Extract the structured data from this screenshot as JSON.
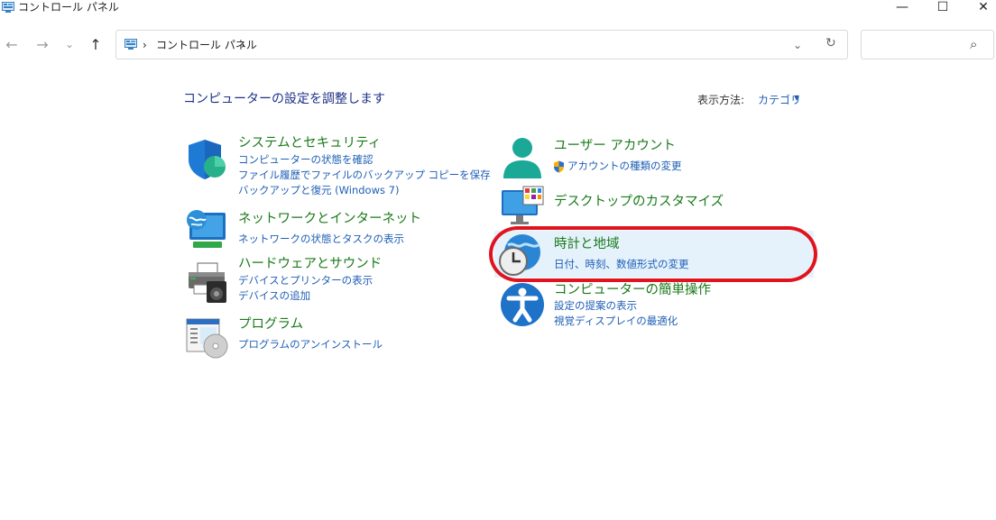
{
  "window": {
    "title": "コントロール パネル",
    "minimize_glyph": "—",
    "maximize_glyph": "☐",
    "close_glyph": "✕"
  },
  "nav": {
    "back_glyph": "←",
    "forward_glyph": "→",
    "recent_glyph": "⌄",
    "up_glyph": "↑"
  },
  "address": {
    "sep_glyph": "›",
    "crumb": "コントロール パネル",
    "dropdown_glyph": "⌄",
    "refresh_glyph": "↻"
  },
  "search": {
    "placeholder": "",
    "icon_glyph": "⌕"
  },
  "main": {
    "heading": "コンピューターの設定を調整します",
    "view_by_label": "表示方法:",
    "view_by_value": "カテゴリ",
    "view_by_arrow": "▾"
  },
  "categories": [
    {
      "title": "システムとセキュリティ",
      "links": [
        "コンピューターの状態を確認",
        "ファイル履歴でファイルのバックアップ コピーを保存",
        "バックアップと復元 (Windows 7)"
      ]
    },
    {
      "title": "ネットワークとインターネット",
      "links": [
        "ネットワークの状態とタスクの表示"
      ]
    },
    {
      "title": "ハードウェアとサウンド",
      "links": [
        "デバイスとプリンターの表示",
        "デバイスの追加"
      ]
    },
    {
      "title": "プログラム",
      "links": [
        "プログラムのアンインストール"
      ]
    },
    {
      "title": "ユーザー アカウント",
      "links": [
        "アカウントの種類の変更"
      ]
    },
    {
      "title": "デスクトップのカスタマイズ",
      "links": []
    },
    {
      "title": "時計と地域",
      "links": [
        "日付、時刻、数値形式の変更"
      ]
    },
    {
      "title": "コンピューターの簡単操作",
      "links": [
        "設定の提案の表示",
        "視覚ディスプレイの最適化"
      ]
    }
  ],
  "colors": {
    "title_green": "#1a7a1a",
    "link_blue": "#1f5fb5",
    "heading_blue": "#1e3287",
    "highlight_bg": "#e5f2fc",
    "annotation_red": "#e0141e"
  }
}
